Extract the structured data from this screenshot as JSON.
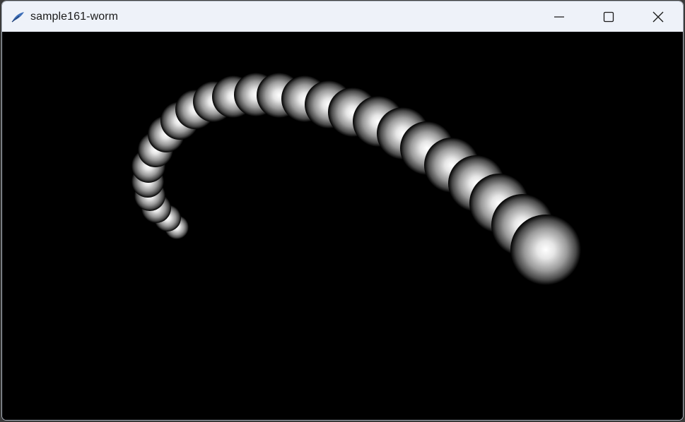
{
  "window": {
    "title": "sample161-worm",
    "app_icon": "feather-icon",
    "controls": {
      "minimize_icon": "minimize-icon",
      "maximize_icon": "maximize-icon",
      "close_icon": "close-icon"
    },
    "colors": {
      "titlebar_bg": "#eef2f9",
      "canvas_bg": "#000000",
      "segment_highlight": "#ffffff"
    }
  },
  "canvas": {
    "scene": "worm",
    "segment_count": 24
  }
}
